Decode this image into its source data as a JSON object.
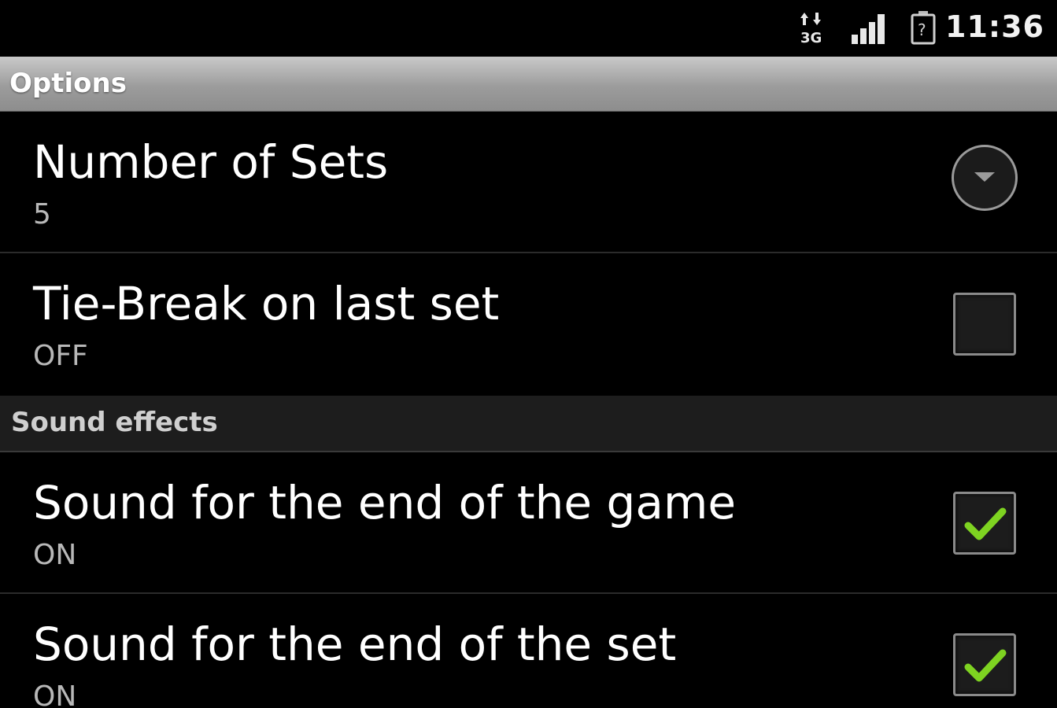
{
  "status_bar": {
    "time": "11:36",
    "network_label": "3G",
    "network_icon": "data-arrows-3g-icon",
    "signal_icon": "signal-strength-icon",
    "battery_icon": "battery-unknown-icon"
  },
  "title_bar": {
    "title": "Options"
  },
  "preferences": [
    {
      "title": "Number of Sets",
      "summary": "5",
      "widget": "dropdown"
    },
    {
      "title": "Tie-Break on last set",
      "summary": "OFF",
      "widget": "checkbox",
      "checked": false
    }
  ],
  "category": {
    "title": "Sound effects"
  },
  "sound_preferences": [
    {
      "title": "Sound for the end of the game",
      "summary": "ON",
      "widget": "checkbox",
      "checked": true
    },
    {
      "title": "Sound for the end of the set",
      "summary": "ON",
      "widget": "checkbox",
      "checked": true
    }
  ],
  "colors": {
    "check_green": "#7ed321",
    "background": "#000000",
    "title_bar_gray": "#9c9c9c"
  }
}
